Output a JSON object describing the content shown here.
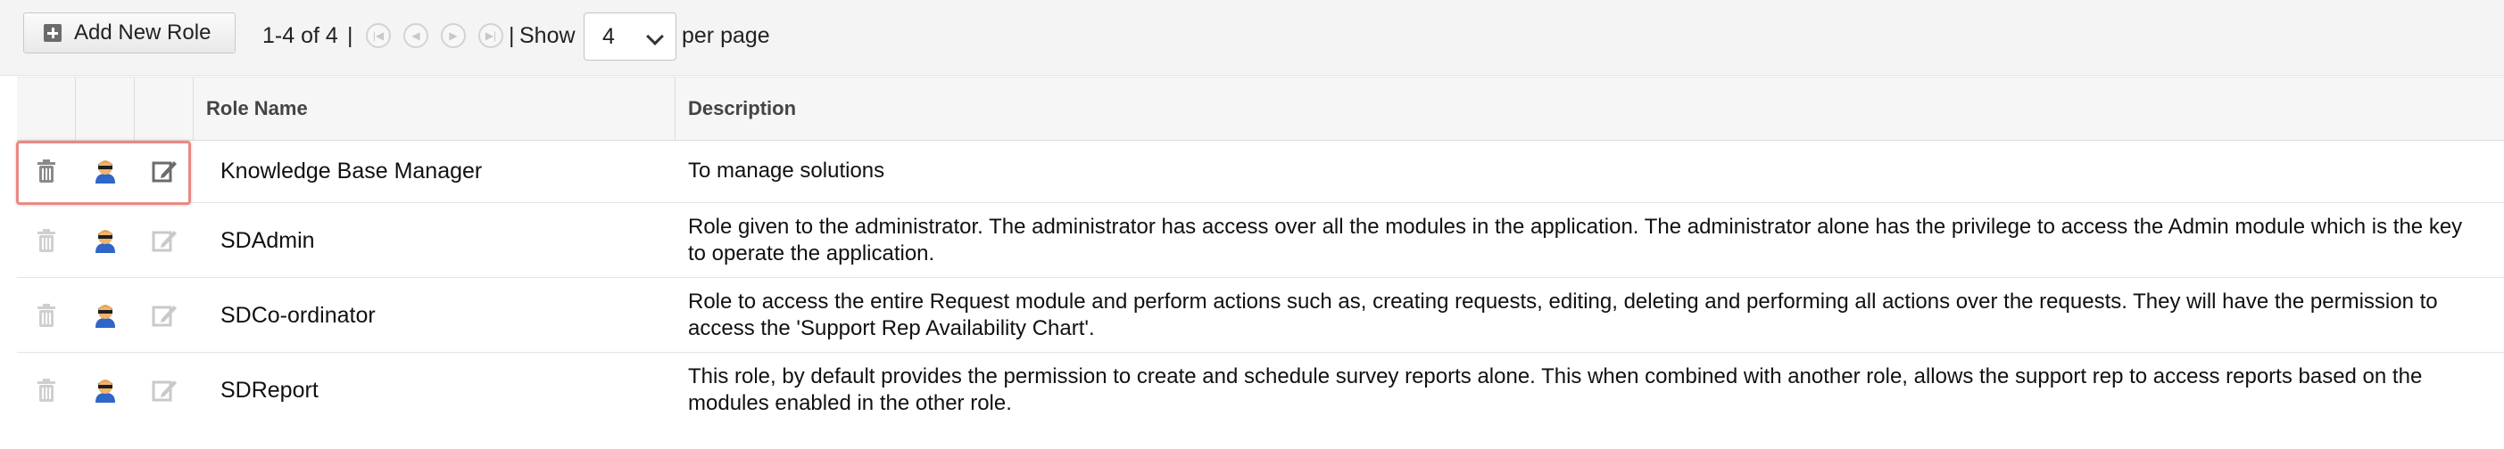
{
  "toolbar": {
    "add_button_label": "Add New Role",
    "range_text": "1-4 of 4",
    "separator_1": "|",
    "separator_2": "|",
    "show_label": "Show",
    "per_page_value": "4",
    "per_page_label": "per page"
  },
  "table": {
    "headers": [
      "Role Name",
      "Description"
    ],
    "rows": [
      {
        "name": "Knowledge Base Manager",
        "description": "To manage solutions"
      },
      {
        "name": "SDAdmin",
        "description": "Role given to the administrator. The administrator has access over all the modules in the application. The administrator alone has the privilege to access the Admin module which is the key to operate the application."
      },
      {
        "name": "SDCo-ordinator",
        "description": "Role to access the entire Request module and perform actions such as, creating requests, editing, deleting and performing all actions over the requests. They will have the permission to access the 'Support Rep Availability Chart'."
      },
      {
        "name": "SDReport",
        "description": "This role, by default provides the permission to create and schedule survey reports alone. This when combined with another role, allows the support rep to access reports based on the modules enabled in the other role."
      }
    ]
  },
  "icons": {
    "add": "plus-square-icon",
    "first": "first-page-icon",
    "prev": "prev-page-icon",
    "next": "next-page-icon",
    "last": "last-page-icon",
    "delete": "trash-icon",
    "user": "user-icon",
    "edit": "edit-icon"
  },
  "colors": {
    "highlight": "#e88a84",
    "user_hair": "#1f1f1f",
    "user_body": "#2f66c7",
    "user_skin": "#f2b36b"
  }
}
